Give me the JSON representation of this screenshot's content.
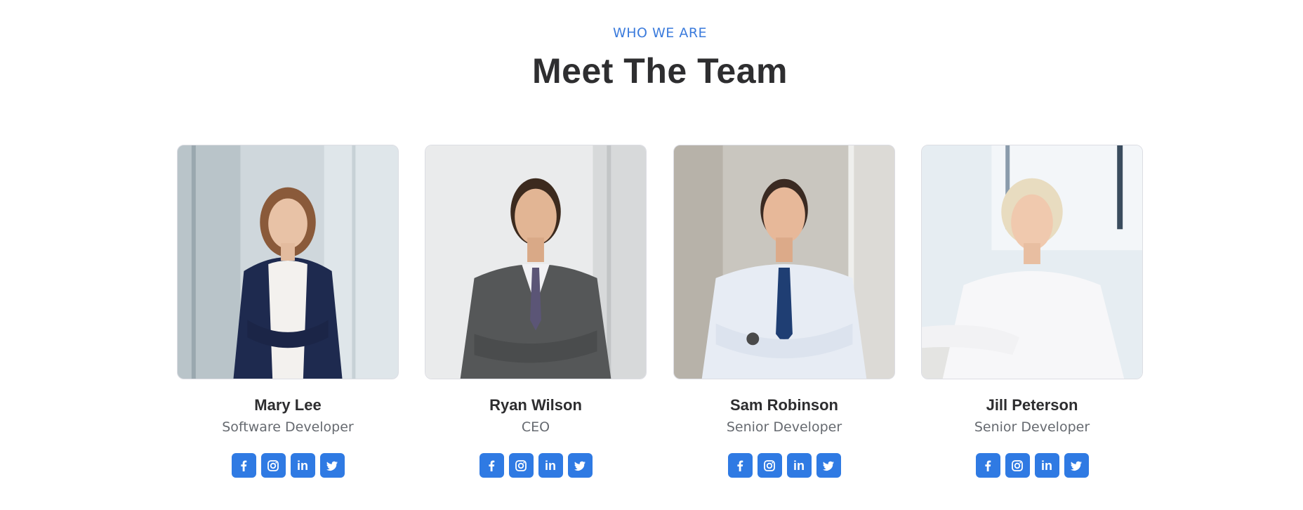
{
  "section": {
    "eyebrow": "WHO WE ARE",
    "title": "Meet The Team"
  },
  "colors": {
    "accent": "#3b7bdc",
    "social_button": "#2f7ae3",
    "heading": "#2e2e30",
    "muted": "#666a70"
  },
  "members": [
    {
      "name": "Mary Lee",
      "role": "Software Developer",
      "photo": "woman-navy-cardigan-photo"
    },
    {
      "name": "Ryan Wilson",
      "role": "CEO",
      "photo": "man-grey-suit-photo"
    },
    {
      "name": "Sam Robinson",
      "role": "Senior Developer",
      "photo": "man-white-shirt-blue-tie-photo"
    },
    {
      "name": "Jill Peterson",
      "role": "Senior Developer",
      "photo": "woman-white-shirt-photo"
    }
  ],
  "social_icons": [
    "facebook-icon",
    "instagram-icon",
    "linkedin-icon",
    "twitter-icon"
  ]
}
